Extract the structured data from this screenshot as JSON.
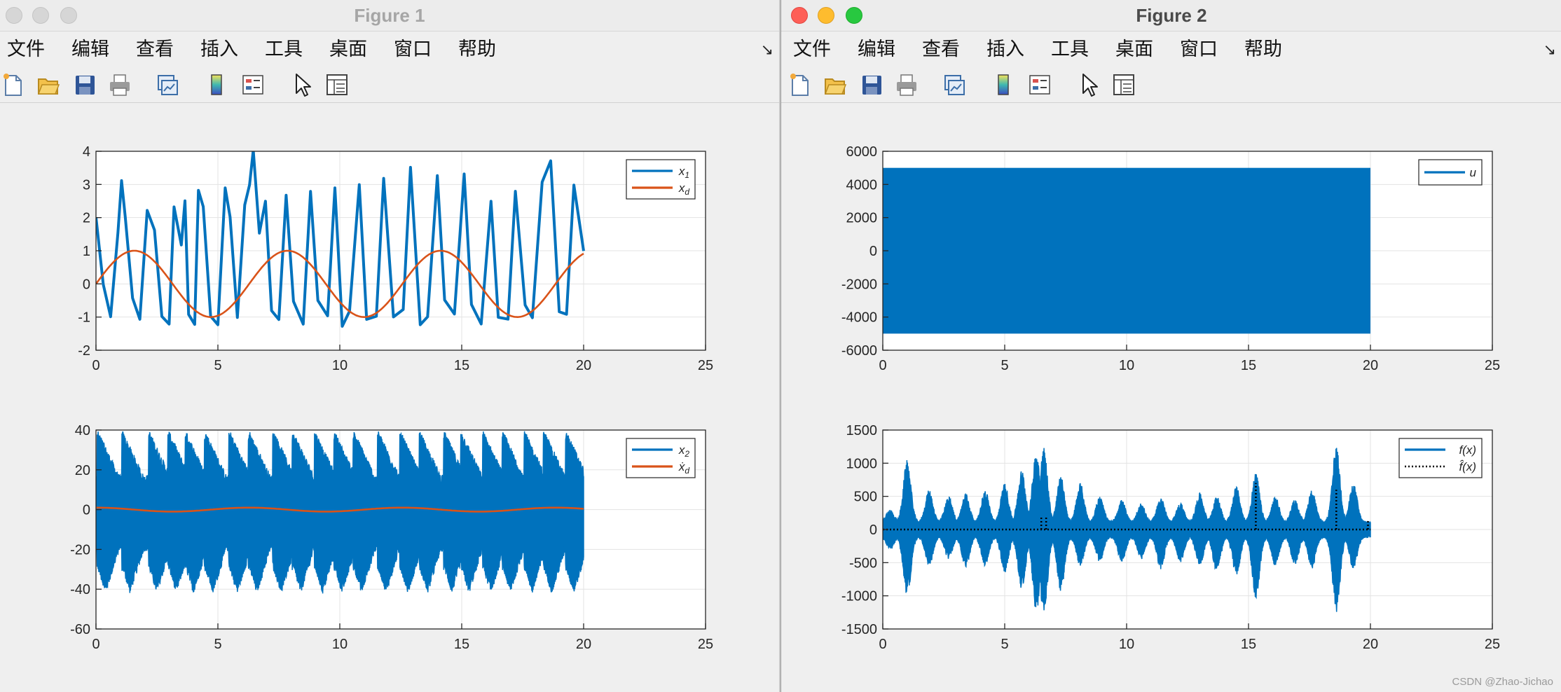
{
  "window1": {
    "title": "Figure 1",
    "menu": [
      "文件",
      "编辑",
      "查看",
      "插入",
      "工具",
      "桌面",
      "窗口",
      "帮助"
    ],
    "toolbar_icons": [
      "new-figure-icon",
      "open-file-icon",
      "save-icon",
      "print-icon",
      "link-plot-icon",
      "colorbar-icon",
      "legend-icon",
      "pointer-icon",
      "property-inspector-icon"
    ]
  },
  "window2": {
    "title": "Figure 2",
    "menu": [
      "文件",
      "编辑",
      "查看",
      "插入",
      "工具",
      "桌面",
      "窗口",
      "帮助"
    ],
    "toolbar_icons": [
      "new-figure-icon",
      "open-file-icon",
      "save-icon",
      "print-icon",
      "link-plot-icon",
      "colorbar-icon",
      "legend-icon",
      "pointer-icon",
      "property-inspector-icon"
    ]
  },
  "watermark": "CSDN @Zhao-Jichao",
  "colors": {
    "blue": "#0072BD",
    "orange": "#D95319",
    "black": "#000000"
  },
  "chart_data": [
    {
      "id": "fig1_top",
      "type": "line",
      "xlim": [
        0,
        25
      ],
      "ylim": [
        -2,
        4
      ],
      "xticks": [
        0,
        5,
        10,
        15,
        20,
        25
      ],
      "yticks": [
        -2,
        -1,
        0,
        1,
        2,
        3,
        4
      ],
      "grid": true,
      "legend": "top-right",
      "series": [
        {
          "name": "x_1",
          "style": "solid",
          "color": "#0072BD",
          "x": [
            0,
            0.3,
            0.6,
            0.9,
            1.05,
            1.2,
            1.5,
            1.8,
            2.1,
            2.4,
            2.7,
            3.0,
            3.2,
            3.5,
            3.65,
            3.8,
            4.05,
            4.2,
            4.4,
            4.7,
            5.0,
            5.3,
            5.5,
            5.8,
            6.1,
            6.3,
            6.45,
            6.7,
            6.95,
            7.2,
            7.5,
            7.8,
            8.1,
            8.5,
            8.8,
            9.1,
            9.5,
            9.8,
            10.1,
            10.4,
            10.8,
            11.1,
            11.5,
            11.8,
            12.2,
            12.6,
            12.9,
            13.3,
            13.6,
            14.0,
            14.3,
            14.7,
            15.1,
            15.4,
            15.8,
            16.2,
            16.5,
            16.9,
            17.2,
            17.6,
            17.9,
            18.3,
            18.65,
            19.0,
            19.3,
            19.6,
            20.0
          ],
          "y": [
            2.0,
            0,
            -1.0,
            1.5,
            3.1,
            2.0,
            -0.4,
            -1.1,
            2.2,
            1.6,
            -1.0,
            -1.2,
            2.3,
            1.2,
            2.5,
            -0.9,
            -1.2,
            2.8,
            2.3,
            -1.0,
            -1.2,
            2.9,
            2.0,
            -1.0,
            2.4,
            3.0,
            4.0,
            1.5,
            2.5,
            -0.8,
            -1.1,
            2.7,
            -0.5,
            -1.2,
            2.8,
            -0.5,
            -1.0,
            2.9,
            -1.3,
            -0.8,
            3.0,
            -1.1,
            -1.0,
            3.2,
            -1.0,
            -0.8,
            3.5,
            -1.2,
            -1.0,
            3.3,
            -0.5,
            -0.9,
            3.3,
            -0.6,
            -1.2,
            2.5,
            -1.0,
            -1.1,
            2.8,
            -0.6,
            -1.0,
            3.1,
            3.7,
            -0.8,
            -0.9,
            3.0,
            1.0
          ]
        },
        {
          "name": "x_d",
          "style": "solid",
          "color": "#D95319",
          "func": "sin",
          "xmin": 0,
          "xmax": 20
        }
      ]
    },
    {
      "id": "fig1_bottom",
      "type": "line",
      "xlim": [
        0,
        25
      ],
      "ylim": [
        -60,
        40
      ],
      "xticks": [
        0,
        5,
        10,
        15,
        20,
        25
      ],
      "yticks": [
        -60,
        -40,
        -20,
        0,
        20,
        40
      ],
      "grid": true,
      "legend": "top-right",
      "series": [
        {
          "name": "x_2",
          "style": "band",
          "color": "#0072BD",
          "xmin": 0,
          "xmax": 20,
          "bursts": [
            0.1,
            1.1,
            2.2,
            3.0,
            3.7,
            4.5,
            5.5,
            6.3,
            7.3,
            8.1,
            9.0,
            9.8,
            10.6,
            11.6,
            12.5,
            13.3,
            14.3,
            15.0,
            15.9,
            16.7,
            17.6,
            18.4,
            19.3
          ],
          "upper_max": 37,
          "upper_min": 15,
          "lower_max": -40,
          "lower_min": -18
        },
        {
          "name": "ẋ_d",
          "style": "solid",
          "color": "#D95319",
          "func": "cos",
          "xmin": 0,
          "xmax": 20
        }
      ]
    },
    {
      "id": "fig2_top",
      "type": "line",
      "xlim": [
        0,
        25
      ],
      "ylim": [
        -6000,
        6000
      ],
      "xticks": [
        0,
        5,
        10,
        15,
        20,
        25
      ],
      "yticks": [
        -6000,
        -4000,
        -2000,
        0,
        2000,
        4000,
        6000
      ],
      "grid": true,
      "legend": "top-right",
      "series": [
        {
          "name": "u",
          "style": "fill",
          "color": "#0072BD",
          "xmin": 0,
          "xmax": 20,
          "ymin": -5000,
          "ymax": 5000
        }
      ]
    },
    {
      "id": "fig2_bottom",
      "type": "line",
      "xlim": [
        0,
        25
      ],
      "ylim": [
        -1500,
        1500
      ],
      "xticks": [
        0,
        5,
        10,
        15,
        20,
        25
      ],
      "yticks": [
        -1500,
        -1000,
        -500,
        0,
        500,
        1000,
        1500
      ],
      "grid": true,
      "legend": "top-right",
      "series": [
        {
          "name": "f(x)",
          "style": "band",
          "color": "#0072BD",
          "xmin": 0,
          "xmax": 20,
          "bursts": [
            0.3,
            1.0,
            1.9,
            2.7,
            3.4,
            4.2,
            5.0,
            5.7,
            6.3,
            6.6,
            7.3,
            8.1,
            8.9,
            9.8,
            10.6,
            11.4,
            12.2,
            13.0,
            13.7,
            14.5,
            15.3,
            16.1,
            16.9,
            17.6,
            18.6,
            19.3
          ],
          "peaks_up": [
            300,
            1050,
            600,
            500,
            550,
            600,
            700,
            900,
            1200,
            1250,
            800,
            700,
            500,
            450,
            400,
            500,
            400,
            550,
            500,
            650,
            850,
            500,
            450,
            600,
            1250,
            700
          ],
          "peaks_down": [
            -300,
            -1000,
            -550,
            -450,
            -600,
            -550,
            -650,
            -900,
            -1250,
            -1300,
            -950,
            -550,
            -500,
            -500,
            -450,
            -600,
            -500,
            -550,
            -650,
            -700,
            -1050,
            -550,
            -550,
            -600,
            -1250,
            -600
          ]
        },
        {
          "name": "f̂(x)",
          "style": "dotted",
          "color": "#000000",
          "xmin": 0,
          "xmax": 20,
          "spikes": [
            [
              6.5,
              200
            ],
            [
              6.7,
              180
            ],
            [
              15.3,
              700
            ],
            [
              18.6,
              600
            ],
            [
              19.9,
              150
            ]
          ]
        }
      ]
    }
  ]
}
